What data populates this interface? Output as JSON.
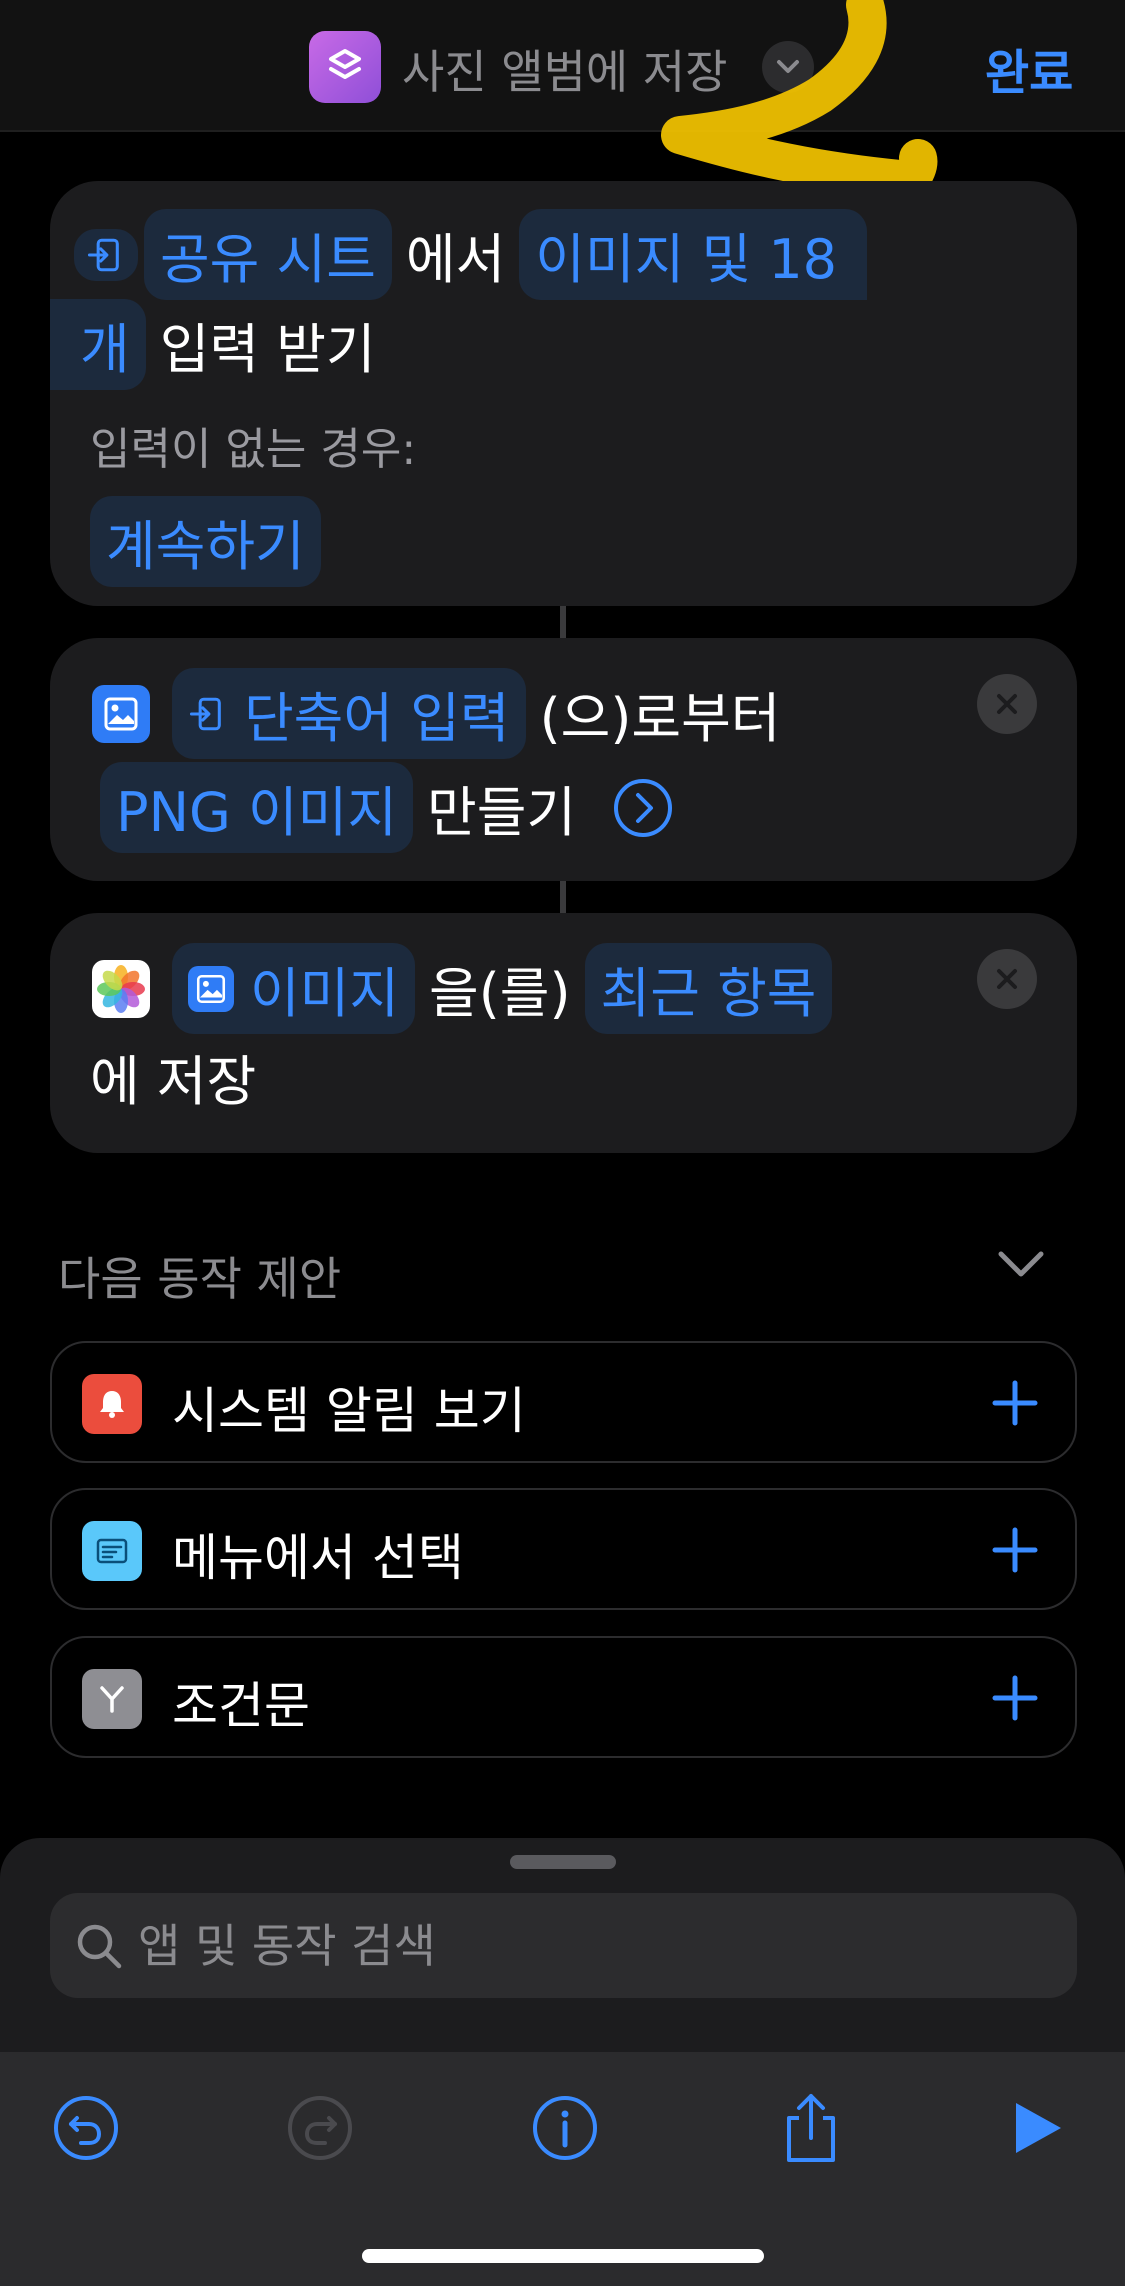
{
  "header": {
    "title": "사진 앨범에 저장",
    "done_label": "완료",
    "app_icon": "shortcuts-icon",
    "accent_color": "#3a8bff"
  },
  "actions": [
    {
      "token_source": "공유 시트",
      "text_from": "에서",
      "token_types_part1": "이미지 및 18",
      "token_types_part2": "개",
      "text_receive": "입력 받기",
      "no_input_label": "입력이 없는 경우:",
      "no_input_value": "계속하기"
    },
    {
      "token_input": "단축어 입력",
      "text_from": "(으)로부터",
      "token_format": "PNG 이미지",
      "text_make": "만들기"
    },
    {
      "token_image": "이미지",
      "text_obj": "을(를)",
      "token_album": "최근 항목",
      "text_save": "에 저장"
    }
  ],
  "suggestions": {
    "heading": "다음 동작 제안",
    "items": [
      {
        "label": "시스템 알림 보기",
        "icon": "notification-icon",
        "color": "#eb4d3d"
      },
      {
        "label": "메뉴에서 선택",
        "icon": "menu-icon",
        "color": "#5ac8fa"
      },
      {
        "label": "조건문",
        "icon": "branch-icon",
        "color": "#8e8e93"
      }
    ]
  },
  "search": {
    "placeholder": "앱 및 동작 검색"
  },
  "toolbar": {
    "buttons": [
      "undo-icon",
      "redo-icon",
      "info-icon",
      "share-icon",
      "play-icon"
    ]
  }
}
